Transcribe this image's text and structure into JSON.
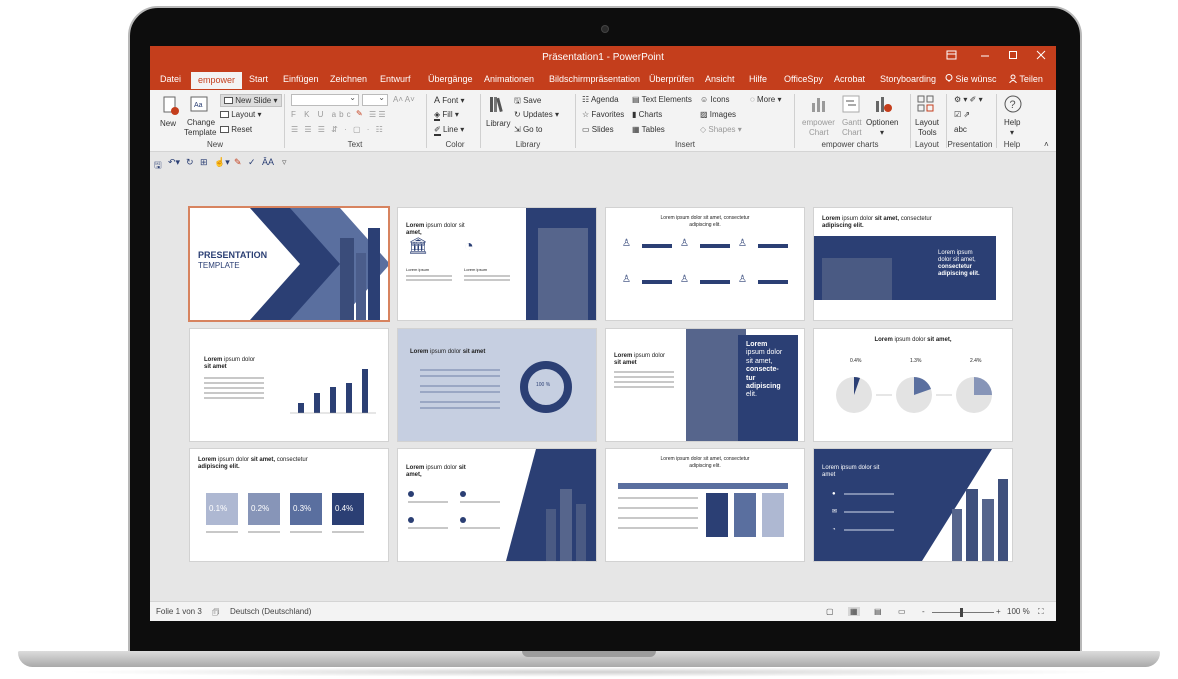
{
  "window": {
    "title": "Präsentation1 - PowerPoint",
    "icon_name": "ribbon-display-icon",
    "minimize_icon": "minimize-icon",
    "maximize_icon": "maximize-icon",
    "close_icon": "close-icon"
  },
  "tabs": [
    {
      "label": "Datei"
    },
    {
      "label": "empower"
    },
    {
      "label": "Start"
    },
    {
      "label": "Einfügen"
    },
    {
      "label": "Zeichnen"
    },
    {
      "label": "Entwurf"
    },
    {
      "label": "Übergänge"
    },
    {
      "label": "Animationen"
    },
    {
      "label": "Bildschirmpräsentation"
    },
    {
      "label": "Überprüfen"
    },
    {
      "label": "Ansicht"
    },
    {
      "label": "Hilfe"
    },
    {
      "label": "OfficeSpy"
    },
    {
      "label": "Acrobat"
    },
    {
      "label": "Storyboarding"
    },
    {
      "label": "Sie wünsc"
    },
    {
      "label": "Teilen"
    }
  ],
  "active_tab": "empower",
  "ribbon": {
    "new_group": {
      "label": "New",
      "new_button": "New",
      "change_template_line1": "Change",
      "change_template_line2": "Template",
      "new_slide": "New Slide",
      "layout": "Layout",
      "reset": "Reset"
    },
    "text_group": {
      "label": "Text"
    },
    "color_group": {
      "label": "Color",
      "font": "Font",
      "fill": "Fill",
      "line": "Line"
    },
    "library_group": {
      "label": "Library",
      "library": "Library",
      "save": "Save",
      "updates": "Updates",
      "goto": "Go to"
    },
    "insert_group": {
      "label": "Insert",
      "agenda": "Agenda",
      "text_elements": "Text Elements",
      "icons": "Icons",
      "more": "More",
      "favorites": "Favorites",
      "charts": "Charts",
      "images": "Images",
      "slides": "Slides",
      "tables": "Tables",
      "shapes": "Shapes"
    },
    "charts_group": {
      "label": "empower charts",
      "empower_chart_1": "empower",
      "empower_chart_2": "Chart",
      "gantt_1": "Gantt",
      "gantt_2": "Chart",
      "optionen": "Optionen"
    },
    "layout_group": {
      "label": "Layout",
      "layout_tools_1": "Layout",
      "layout_tools_2": "Tools"
    },
    "presentation_group": {
      "label": "Presentation"
    },
    "help_group": {
      "label": "Help",
      "help": "Help"
    }
  },
  "slides": {
    "s1": {
      "title": "PRESENTATION",
      "subtitle": "TEMPLATE"
    },
    "s2": {
      "title_bold": "Lorem",
      "title_rest": "ipsum dolor sit",
      "title_line2": "amet,",
      "col1": "Lorem ipsum",
      "col2": "Lorem ipsum"
    },
    "s3": {
      "title_line1": "Lorem ipsum dolor sit amet, consectetur",
      "title_line2": "adipiscing elit."
    },
    "s4": {
      "title_a": "Lorem",
      "title_b": "ipsum dolor",
      "title_c": "sit amet,",
      "title_d": "consectetur",
      "title_line2": "adipiscing elit.",
      "box_l1": "Lorem ipsum",
      "box_l2": "dolor sit amet,",
      "box_l3": "consectetur",
      "box_l4": "adipiscing elit."
    },
    "s5": {
      "title_a": "Lorem",
      "title_b": "ipsum dolor",
      "title_line2": "sit amet"
    },
    "s6": {
      "title_a": "Lorem",
      "title_b": "ipsum dolor",
      "title_c": "sit amet",
      "donut_label": "100 %"
    },
    "s7": {
      "title_a": "Lorem",
      "title_b": "ipsum dolor",
      "title_line2": "sit amet",
      "box_l1": "Lorem",
      "box_l2": "ipsum dolor",
      "box_l3": "sit amet,",
      "box_l4": "consecte-",
      "box_l5": "tur",
      "box_l6": "adipiscing",
      "box_l7": "elit."
    },
    "s8": {
      "title_a": "Lorem",
      "title_b": "ipsum dolor",
      "title_c": "sit amet,",
      "pct1": "0.4%",
      "pct2": "1.3%",
      "pct3": "2.4%"
    },
    "s9": {
      "title_a": "Lorem",
      "title_b": "ipsum dolor",
      "title_c": "sit amet,",
      "title_d": "consectetur",
      "title_line2": "adipiscing elit.",
      "v1": "0.1%",
      "v2": "0.2%",
      "v3": "0.3%",
      "v4": "0.4%"
    },
    "s10": {
      "title_a": "Lorem",
      "title_b": "ipsum dolor",
      "title_c": "sit",
      "title_line2": "amet,"
    },
    "s11": {
      "title_line1": "Lorem ipsum dolor sit amet, consectetur",
      "title_line2": "adipiscing elit."
    },
    "s12": {
      "title_line1": "Lorem ipsum dolor sit",
      "title_line2": "amet"
    }
  },
  "status": {
    "slide_counter": "Folie 1 von 3",
    "language": "Deutsch (Deutschland)",
    "zoom": "100 %",
    "zoom_minus": "-",
    "zoom_plus": "+"
  },
  "colors": {
    "ppt_accent": "#c43e1c",
    "navy": "#2b3f74",
    "mid_blue": "#5a6f9f",
    "pale_blue": "#c6cfe1",
    "selection": "#d7835f"
  }
}
